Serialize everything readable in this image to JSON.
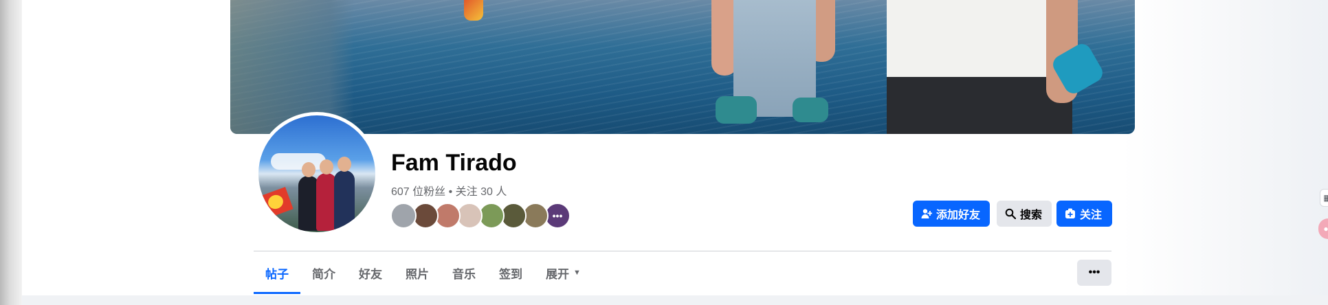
{
  "profile": {
    "name": "Fam Tirado",
    "stats": "607 位粉丝 • 关注 30 人"
  },
  "friend_avatars": [
    {
      "name": "friend-avatar-1",
      "color": "#9fa4ab",
      "label": ""
    },
    {
      "name": "friend-avatar-2",
      "color": "#6b4a3a",
      "label": ""
    },
    {
      "name": "friend-avatar-3",
      "color": "#c07a6a",
      "label": ""
    },
    {
      "name": "friend-avatar-4",
      "color": "#d8c3b8",
      "label": ""
    },
    {
      "name": "friend-avatar-5",
      "color": "#7c9a58",
      "label": ""
    },
    {
      "name": "friend-avatar-6",
      "color": "#5a5a3a",
      "label": ""
    },
    {
      "name": "friend-avatar-7",
      "color": "#8a7a5a",
      "label": ""
    },
    {
      "name": "friend-avatar-more",
      "color": "#5b3a78",
      "label": "•••"
    }
  ],
  "actions": {
    "add_friend": "添加好友",
    "search": "搜索",
    "follow": "关注"
  },
  "tabs": [
    {
      "label": "帖子",
      "active": true
    },
    {
      "label": "简介",
      "active": false
    },
    {
      "label": "好友",
      "active": false
    },
    {
      "label": "照片",
      "active": false
    },
    {
      "label": "音乐",
      "active": false
    },
    {
      "label": "签到",
      "active": false
    },
    {
      "label": "展开",
      "active": false
    }
  ],
  "more_button": "•••",
  "colors": {
    "accent": "#0866ff",
    "secondary_button": "#e4e6eb",
    "text_primary": "#050505",
    "text_secondary": "#65676b"
  }
}
